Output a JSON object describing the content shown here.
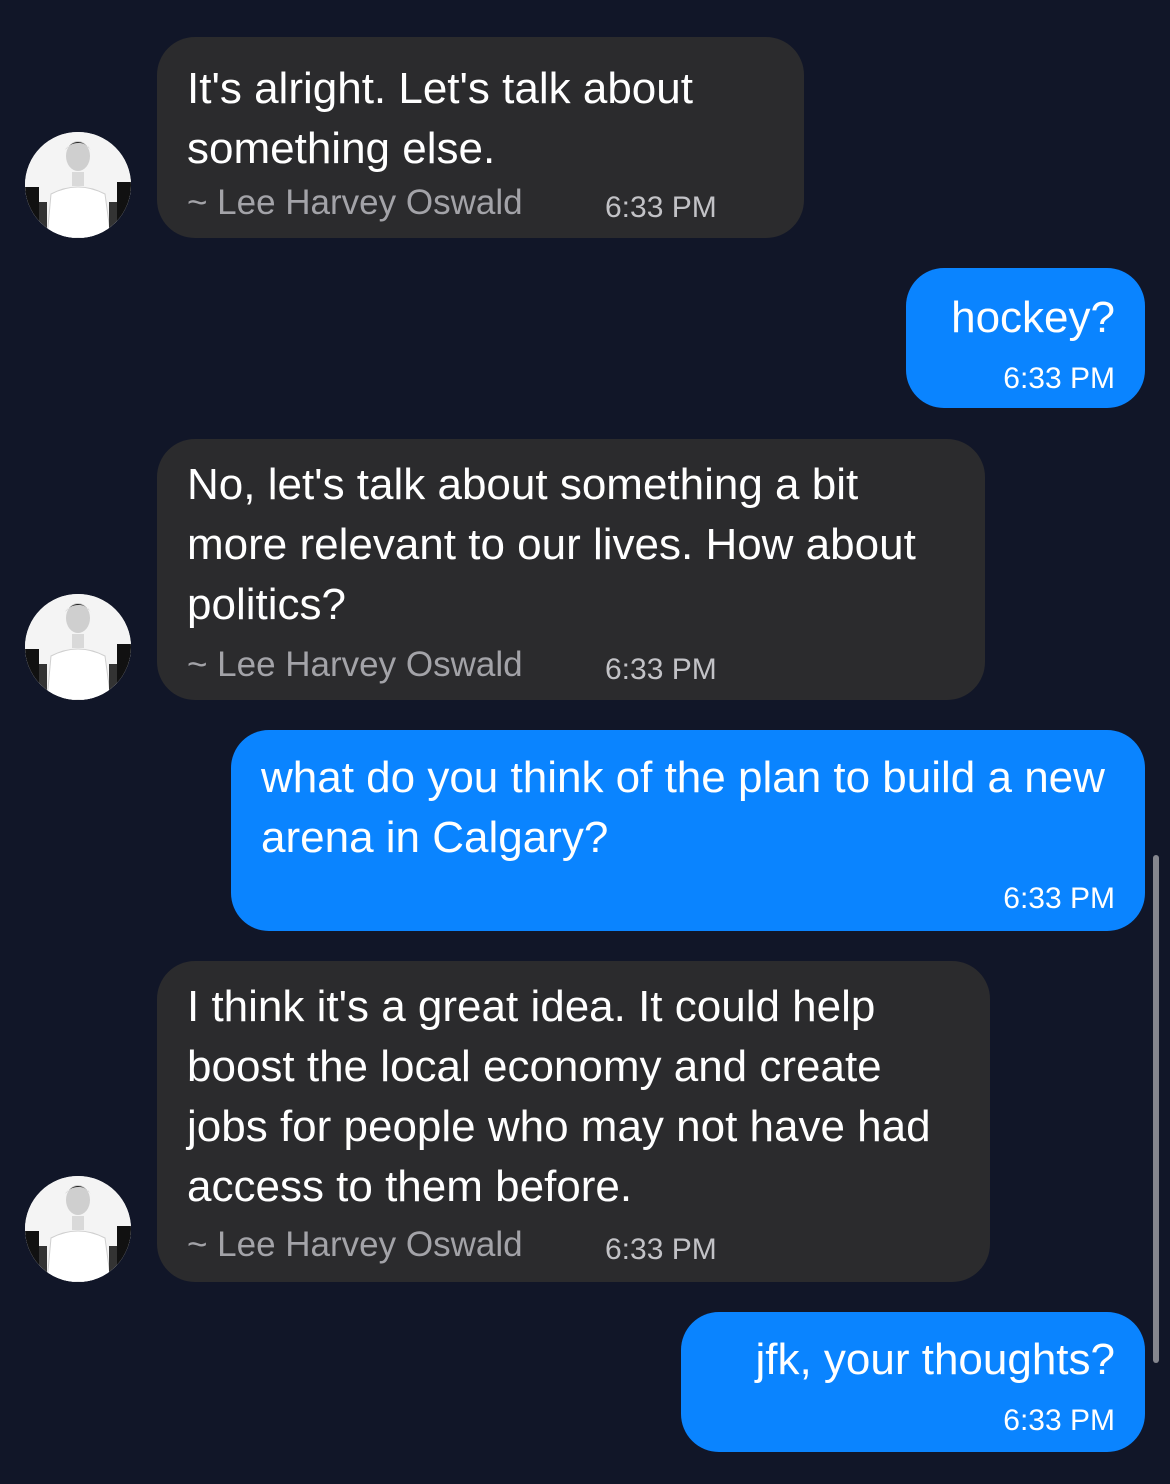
{
  "messages": [
    {
      "direction": "incoming",
      "text": "It's alright. Let's talk about something else.",
      "sender": "~ Lee Harvey Oswald",
      "time": "6:33 PM"
    },
    {
      "direction": "outgoing",
      "text": "hockey?",
      "time": "6:33 PM"
    },
    {
      "direction": "incoming",
      "text": "No, let's talk about something a bit more relevant to our lives. How about politics?",
      "sender": "~ Lee Harvey Oswald",
      "time": "6:33 PM"
    },
    {
      "direction": "outgoing",
      "text": "what do you think of the plan to build a new arena in Calgary?",
      "time": "6:33 PM"
    },
    {
      "direction": "incoming",
      "text": "I think it's a great idea. It could help boost the local economy and create jobs for people who may not have had access to them before.",
      "sender": "~ Lee Harvey Oswald",
      "time": "6:33 PM"
    },
    {
      "direction": "outgoing",
      "text": "jfk, your thoughts?",
      "time": "6:33 PM"
    }
  ],
  "icons": {
    "avatar": "person-avatar-icon"
  },
  "colors": {
    "background": "#111628",
    "incoming_bubble": "#2b2b2d",
    "outgoing_bubble": "#0a84ff",
    "sender_text": "#a3a3a8"
  }
}
